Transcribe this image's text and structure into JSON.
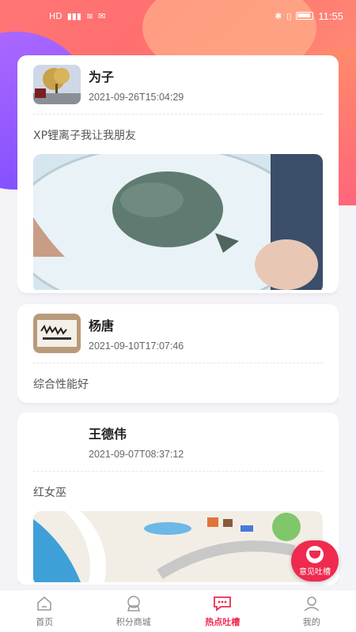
{
  "status_bar": {
    "left_text": "HD",
    "signal": "4G",
    "time": "11:55"
  },
  "posts": [
    {
      "name": "为子",
      "date": "2021-09-26T15:04:29",
      "content": "XP锂离子我让我朋友",
      "avatar": "tree-photo",
      "image": "turtle-in-container-photo"
    },
    {
      "name": "杨唐",
      "date": "2021-09-10T17:07:46",
      "content": "综合性能好",
      "avatar": "calligraphy-photo"
    },
    {
      "name": "王德伟",
      "date": "2021-09-07T08:37:12",
      "content": "红女巫",
      "image": "cartoon-map-illustration"
    }
  ],
  "fab": {
    "label": "意见吐槽",
    "icon": "angry-face-icon"
  },
  "tabs": [
    {
      "label": "首页",
      "icon": "home-icon"
    },
    {
      "label": "积分商城",
      "icon": "points-mall-icon"
    },
    {
      "label": "热点吐槽",
      "icon": "chat-bubble-icon"
    },
    {
      "label": "我的",
      "icon": "profile-icon"
    }
  ],
  "active_tab": 2,
  "colors": {
    "accent": "#ee2a4f",
    "gradient_pink": "#ff7a7a",
    "gradient_purple": "#7e4dff"
  }
}
